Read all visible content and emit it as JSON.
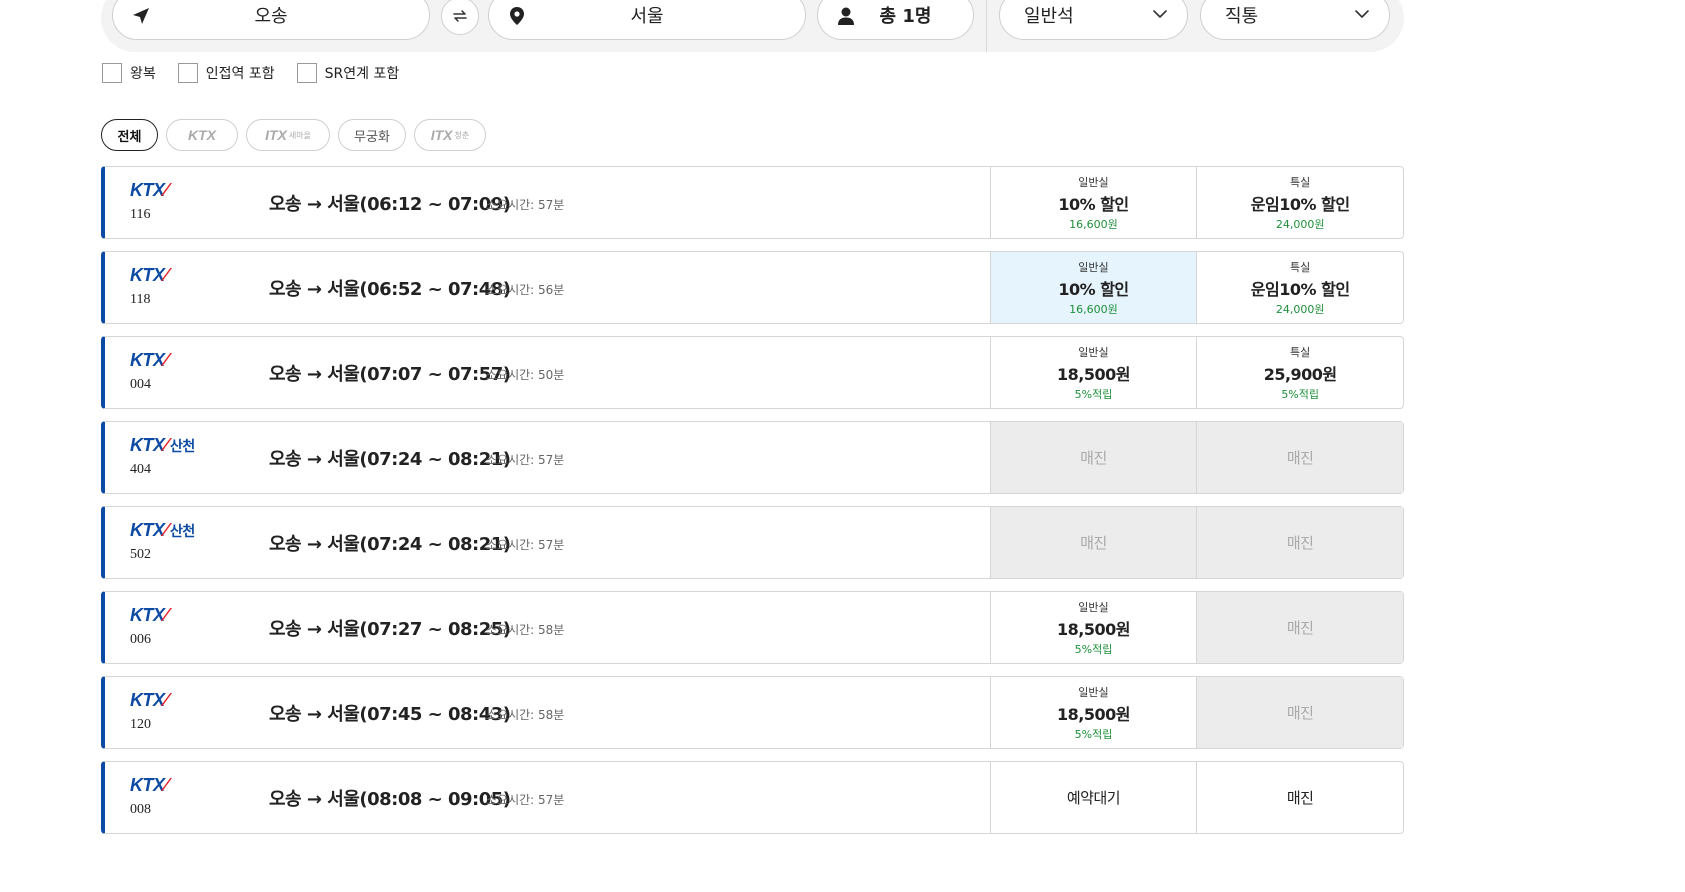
{
  "search": {
    "departure": "오송",
    "arrival": "서울",
    "passengers": "총 1명",
    "seat_class": "일반석",
    "route_type": "직통"
  },
  "options": [
    {
      "label": "왕복"
    },
    {
      "label": "인접역 포함"
    },
    {
      "label": "SR연계 포함"
    }
  ],
  "filters": {
    "all": "전체",
    "ktx": "KTX",
    "itx_saemaeul": "ITX",
    "itx_saemaeul_sub": "새마을",
    "mugunghwa": "무궁화",
    "itx_cheongchun": "ITX",
    "itx_cheongchun_sub": "청춘"
  },
  "trains": [
    {
      "brand": "KTX",
      "brand_sub": "",
      "number": "116",
      "route": "오송 → 서울(06:12 ~ 07:09)",
      "duration": "소요시간: 57분",
      "general": {
        "label": "일반실",
        "main": "10% 할인",
        "sub": "16,600원",
        "state": "available"
      },
      "special": {
        "label": "특실",
        "main": "운임10% 할인",
        "sub": "24,000원",
        "state": "available"
      }
    },
    {
      "brand": "KTX",
      "brand_sub": "",
      "number": "118",
      "route": "오송 → 서울(06:52 ~ 07:48)",
      "duration": "소요시간: 56분",
      "general": {
        "label": "일반실",
        "main": "10% 할인",
        "sub": "16,600원",
        "state": "selected"
      },
      "special": {
        "label": "특실",
        "main": "운임10% 할인",
        "sub": "24,000원",
        "state": "available"
      }
    },
    {
      "brand": "KTX",
      "brand_sub": "",
      "number": "004",
      "route": "오송 → 서울(07:07 ~ 07:57)",
      "duration": "소요시간: 50분",
      "general": {
        "label": "일반실",
        "main": "18,500원",
        "sub": "5%적립",
        "state": "available"
      },
      "special": {
        "label": "특실",
        "main": "25,900원",
        "sub": "5%적립",
        "state": "available"
      }
    },
    {
      "brand": "KTX",
      "brand_sub": "산천",
      "number": "404",
      "route": "오송 → 서울(07:24 ~ 08:21)",
      "duration": "소요시간: 57분",
      "general": {
        "label": "",
        "main": "매진",
        "sub": "",
        "state": "soldout"
      },
      "special": {
        "label": "",
        "main": "매진",
        "sub": "",
        "state": "soldout"
      }
    },
    {
      "brand": "KTX",
      "brand_sub": "산천",
      "number": "502",
      "route": "오송 → 서울(07:24 ~ 08:21)",
      "duration": "소요시간: 57분",
      "general": {
        "label": "",
        "main": "매진",
        "sub": "",
        "state": "soldout"
      },
      "special": {
        "label": "",
        "main": "매진",
        "sub": "",
        "state": "soldout"
      }
    },
    {
      "brand": "KTX",
      "brand_sub": "",
      "number": "006",
      "route": "오송 → 서울(07:27 ~ 08:25)",
      "duration": "소요시간: 58분",
      "general": {
        "label": "일반실",
        "main": "18,500원",
        "sub": "5%적립",
        "state": "available"
      },
      "special": {
        "label": "",
        "main": "매진",
        "sub": "",
        "state": "soldout"
      }
    },
    {
      "brand": "KTX",
      "brand_sub": "",
      "number": "120",
      "route": "오송 → 서울(07:45 ~ 08:43)",
      "duration": "소요시간: 58분",
      "general": {
        "label": "일반실",
        "main": "18,500원",
        "sub": "5%적립",
        "state": "available"
      },
      "special": {
        "label": "",
        "main": "매진",
        "sub": "",
        "state": "soldout"
      }
    },
    {
      "brand": "KTX",
      "brand_sub": "",
      "number": "008",
      "route": "오송 → 서울(08:08 ~ 09:05)",
      "duration": "소요시간: 57분",
      "general": {
        "label": "",
        "main": "예약대기",
        "sub": "",
        "state": "plain"
      },
      "special": {
        "label": "",
        "main": "매진",
        "sub": "",
        "state": "plain"
      }
    }
  ],
  "colors": {
    "brand_blue": "#0d4aa3",
    "discount_green": "#1f8f3a",
    "selected_bg": "#e6f4fd",
    "soldout_bg": "#ececec"
  }
}
